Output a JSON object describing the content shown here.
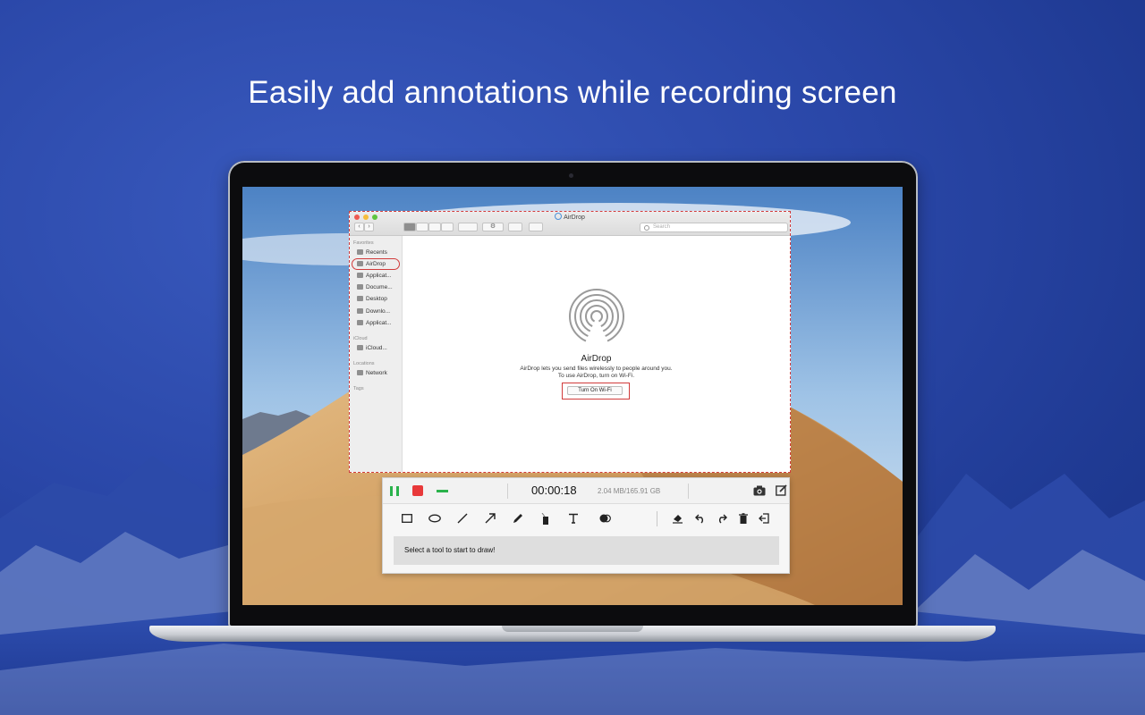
{
  "headline": "Easily add annotations while recording screen",
  "finder": {
    "title": "AirDrop",
    "search_placeholder": "Search",
    "sidebar": {
      "sections": [
        {
          "header": "Favorites",
          "items": [
            "Recents",
            "AirDrop",
            "Applicat...",
            "Docume...",
            "Desktop",
            "Downlo...",
            "Applicat..."
          ]
        },
        {
          "header": "iCloud",
          "items": [
            "iCloud..."
          ]
        },
        {
          "header": "Locations",
          "items": [
            "Network"
          ]
        },
        {
          "header": "Tags",
          "items": []
        }
      ]
    },
    "airdrop": {
      "name": "AirDrop",
      "desc_line1": "AirDrop lets you send files wirelessly to people around you.",
      "desc_line2": "To use AirDrop, turn on Wi-Fi.",
      "wifi_button": "Turn On Wi-Fi"
    }
  },
  "recorder": {
    "timer": "00:00:18",
    "storage": "2.04 MB/165.91 GB",
    "hint": "Select a tool to start to draw!",
    "tools": [
      "rectangle-icon",
      "ellipse-icon",
      "line-icon",
      "arrow-icon",
      "pencil-icon",
      "marker-icon",
      "text-icon",
      "blur-icon"
    ],
    "actions": [
      "eraser-icon",
      "undo-icon",
      "redo-icon",
      "trash-icon",
      "exit-icon"
    ],
    "colors": {
      "pause": "#2bb24c",
      "stop": "#e8393a",
      "minimize": "#2bb24c"
    }
  }
}
